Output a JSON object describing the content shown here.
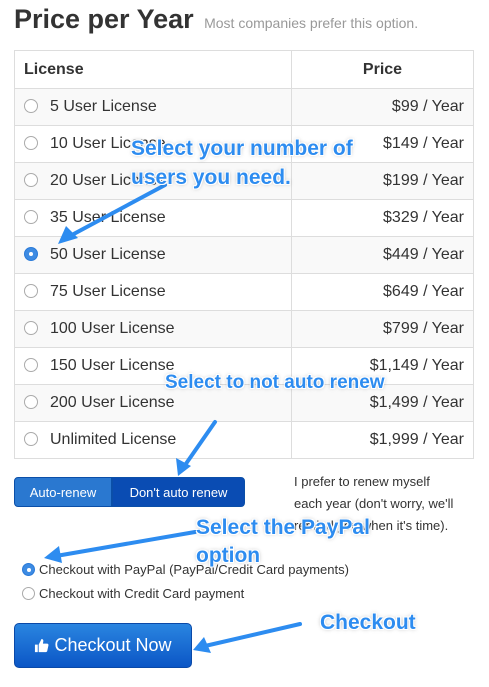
{
  "header": {
    "title": "Price per Year",
    "subtitle": "Most companies prefer this option."
  },
  "table": {
    "columns": [
      "License",
      "Price"
    ],
    "rows": [
      {
        "license": "5 User License",
        "price": "$99 / Year",
        "selected": false
      },
      {
        "license": "10 User License",
        "price": "$149 / Year",
        "selected": false
      },
      {
        "license": "20 User License",
        "price": "$199 / Year",
        "selected": false
      },
      {
        "license": "35 User License",
        "price": "$329 / Year",
        "selected": false
      },
      {
        "license": "50 User License",
        "price": "$449 / Year",
        "selected": true
      },
      {
        "license": "75 User License",
        "price": "$649 / Year",
        "selected": false
      },
      {
        "license": "100 User License",
        "price": "$799 / Year",
        "selected": false
      },
      {
        "license": "150 User License",
        "price": "$1,149 / Year",
        "selected": false
      },
      {
        "license": "200 User License",
        "price": "$1,499 / Year",
        "selected": false
      },
      {
        "license": "Unlimited License",
        "price": "$1,999 / Year",
        "selected": false
      }
    ]
  },
  "renew": {
    "auto_label": "Auto-renew",
    "no_auto_label": "Don't auto renew",
    "active": "no_auto",
    "note_line1": "I prefer to renew myself",
    "note_line2": "each year (don't worry, we'll",
    "note_line3": "remind you when it's time)."
  },
  "payment": {
    "options": [
      {
        "label": "Checkout with PayPal (PayPal/Credit Card payments)",
        "selected": true
      },
      {
        "label": "Checkout with Credit Card payment",
        "selected": false
      }
    ]
  },
  "checkout": {
    "label": "Checkout Now",
    "icon": "thumbs-up-icon"
  },
  "annotations": {
    "select_users_line1": "Select your number of",
    "select_users_line2": "users you need.",
    "auto_renew": "Select to not auto renew",
    "paypal_line1": "Select the PayPal",
    "paypal_line2": "option",
    "checkout": "Checkout"
  },
  "colors": {
    "annotation": "#2d8cf0",
    "button_primary": "#0a4cb3",
    "radio_selected": "#3d8be3"
  }
}
